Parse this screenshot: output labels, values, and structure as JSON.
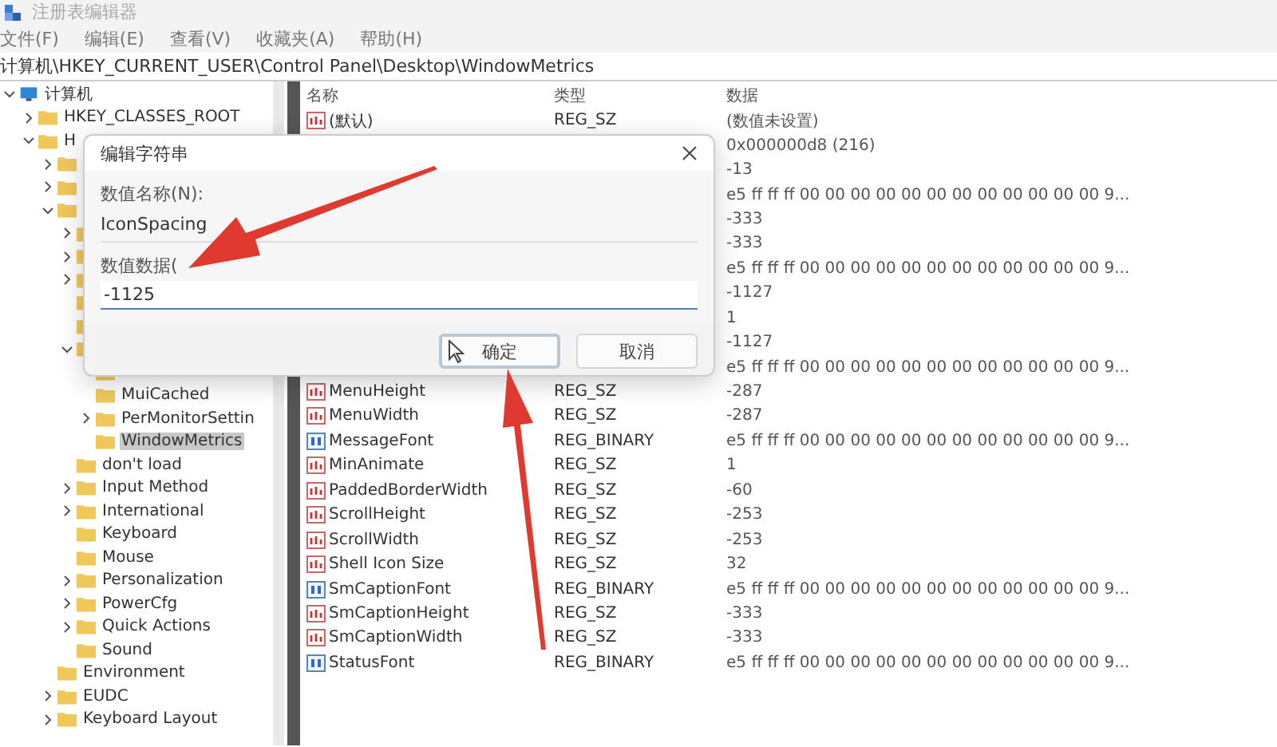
{
  "window": {
    "title": "注册表编辑器"
  },
  "menu": [
    "文件(F)",
    "编辑(E)",
    "查看(V)",
    "收藏夹(A)",
    "帮助(H)"
  ],
  "address": "计算机\\HKEY_CURRENT_USER\\Control Panel\\Desktop\\WindowMetrics",
  "tree": [
    {
      "label": "计算机",
      "kind": "computer",
      "expanded": true,
      "selected": false,
      "children": [
        {
          "label": "HKEY_CLASSES_ROOT",
          "kind": "folder",
          "expanded": false,
          "selected": false
        },
        {
          "label": "H",
          "kind": "folder",
          "expanded": true,
          "selected": false,
          "children": [
            {
              "kind": "folder",
              "expanded": false
            },
            {
              "kind": "folder",
              "expanded": false
            },
            {
              "kind": "folder",
              "expanded": true,
              "children": [
                {
                  "kind": "folder",
                  "expanded": false
                },
                {
                  "kind": "folder",
                  "expanded": false
                },
                {
                  "kind": "folder",
                  "expanded": false
                },
                {
                  "kind": "folder"
                },
                {
                  "kind": "folder"
                },
                {
                  "kind": "folder",
                  "expanded": true,
                  "children": [
                    {
                      "kind": "folder"
                    },
                    {
                      "label": "MuiCached",
                      "kind": "folder",
                      "selected": false
                    },
                    {
                      "label": "PerMonitorSettin",
                      "kind": "folder",
                      "expanded": false,
                      "selected": false
                    },
                    {
                      "label": "WindowMetrics",
                      "kind": "folder",
                      "selected": true
                    }
                  ]
                },
                {
                  "label": "don't load",
                  "kind": "folder",
                  "selected": false
                },
                {
                  "label": "Input Method",
                  "kind": "folder",
                  "expanded": false,
                  "selected": false
                },
                {
                  "label": "International",
                  "kind": "folder",
                  "expanded": false,
                  "selected": false
                },
                {
                  "label": "Keyboard",
                  "kind": "folder",
                  "selected": false
                },
                {
                  "label": "Mouse",
                  "kind": "folder",
                  "selected": false
                },
                {
                  "label": "Personalization",
                  "kind": "folder",
                  "expanded": false,
                  "selected": false
                },
                {
                  "label": "PowerCfg",
                  "kind": "folder",
                  "expanded": false,
                  "selected": false
                },
                {
                  "label": "Quick Actions",
                  "kind": "folder",
                  "expanded": false,
                  "selected": false
                },
                {
                  "label": "Sound",
                  "kind": "folder",
                  "selected": false
                }
              ]
            },
            {
              "label": "Environment",
              "kind": "folder",
              "selected": false
            },
            {
              "label": "EUDC",
              "kind": "folder",
              "expanded": false,
              "selected": false
            },
            {
              "label": "Keyboard Layout",
              "kind": "folder",
              "expanded": false,
              "selected": false
            }
          ]
        }
      ]
    }
  ],
  "table": {
    "columns": [
      "名称",
      "类型",
      "数据"
    ],
    "rows": [
      {
        "name": "(默认)",
        "type": "REG_SZ",
        "kind": "string",
        "data": "(数值未设置)"
      },
      {
        "data": "0x000000d8 (216)"
      },
      {
        "data": "-13"
      },
      {
        "data": "e5 ff ff ff 00 00 00 00 00 00 00 00 00 00 00 00 9..."
      },
      {
        "data": "-333"
      },
      {
        "data": "-333"
      },
      {
        "data": "e5 ff ff ff 00 00 00 00 00 00 00 00 00 00 00 00 9..."
      },
      {
        "data": "-1127"
      },
      {
        "data": "1"
      },
      {
        "data": "-1127"
      },
      {
        "data": "e5 ff ff ff 00 00 00 00 00 00 00 00 00 00 00 00 9..."
      },
      {
        "name": "MenuHeight",
        "type": "REG_SZ",
        "kind": "string",
        "data": "-287"
      },
      {
        "name": "MenuWidth",
        "type": "REG_SZ",
        "kind": "string",
        "data": "-287"
      },
      {
        "name": "MessageFont",
        "type": "REG_BINARY",
        "kind": "binary",
        "data": "e5 ff ff ff 00 00 00 00 00 00 00 00 00 00 00 00 9..."
      },
      {
        "name": "MinAnimate",
        "type": "REG_SZ",
        "kind": "string",
        "data": "1"
      },
      {
        "name": "PaddedBorderWidth",
        "type": "REG_SZ",
        "kind": "string",
        "data": "-60"
      },
      {
        "name": "ScrollHeight",
        "type": "REG_SZ",
        "kind": "string",
        "data": "-253"
      },
      {
        "name": "ScrollWidth",
        "type": "REG_SZ",
        "kind": "string",
        "data": "-253"
      },
      {
        "name": "Shell Icon Size",
        "type": "REG_SZ",
        "kind": "string",
        "data": "32"
      },
      {
        "name": "SmCaptionFont",
        "type": "REG_BINARY",
        "kind": "binary",
        "data": "e5 ff ff ff 00 00 00 00 00 00 00 00 00 00 00 00 9..."
      },
      {
        "name": "SmCaptionHeight",
        "type": "REG_SZ",
        "kind": "string",
        "data": "-333"
      },
      {
        "name": "SmCaptionWidth",
        "type": "REG_SZ",
        "kind": "string",
        "data": "-333"
      },
      {
        "name": "StatusFont",
        "type": "REG_BINARY",
        "kind": "binary",
        "data": "e5 ff ff ff 00 00 00 00 00 00 00 00 00 00 00 00 9..."
      }
    ]
  },
  "dialog": {
    "title": "编辑字符串",
    "name_label": "数值名称(N):",
    "name_value": "IconSpacing",
    "data_label": "数值数据(",
    "data_value": "-1125",
    "buttons": [
      {
        "label": "确定",
        "focused": true
      },
      {
        "label": "取消",
        "focused": false
      }
    ]
  }
}
